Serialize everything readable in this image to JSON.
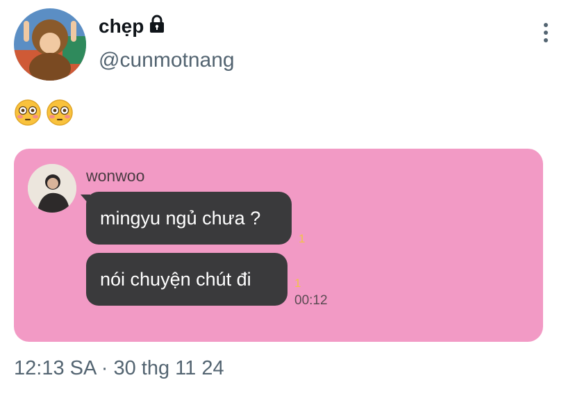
{
  "author": {
    "display_name": "chẹp",
    "handle": "@cunmotnang",
    "protected_icon": "lock-icon",
    "avatar": "profile-photo-child-in-monkey-costume"
  },
  "menu": {
    "icon": "more-vertical-icon"
  },
  "tweet": {
    "text": "😳😳"
  },
  "media": {
    "background_color": "#f29ac5",
    "chat": {
      "sender": "wonwoo",
      "avatar": "profile-photo-person-seated",
      "messages": [
        {
          "text": "mingyu ngủ chưa ?",
          "unread": "1"
        },
        {
          "text": "nói chuyện chút đi",
          "unread": "1",
          "time": "00:12"
        }
      ]
    }
  },
  "timestamp": "12:13 SA · 30 thg 11 24",
  "colors": {
    "bubble": "#3a3a3c",
    "unread": "#f2c24a",
    "meta_text": "#536471"
  }
}
